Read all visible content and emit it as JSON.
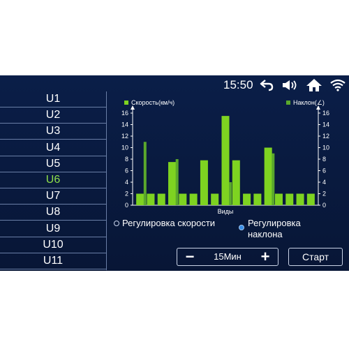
{
  "status": {
    "time": "15:50",
    "icons": [
      "back-arrow-icon",
      "volume-icon",
      "home-icon",
      "wifi-icon"
    ]
  },
  "sidebar": {
    "items": [
      "U1",
      "U2",
      "U3",
      "U4",
      "U5",
      "U6",
      "U7",
      "U8",
      "U9",
      "U10",
      "U11"
    ],
    "active_index": 5,
    "active_color": "#8fe04a"
  },
  "chart_data": {
    "type": "bar",
    "legend_left": "Скорость(км/ч)",
    "legend_right": "Наклон(∠)",
    "xlabel": "Виды",
    "ylim": [
      0,
      16
    ],
    "yticks": [
      0,
      2,
      4,
      6,
      8,
      10,
      12,
      14,
      16
    ],
    "series": [
      {
        "name": "Скорость(км/ч)",
        "color": "#7ed321",
        "values": [
          2,
          2,
          2,
          7.5,
          2,
          2,
          7.8,
          2,
          15.5,
          7.8,
          2,
          2,
          10,
          2,
          2,
          2,
          2
        ]
      },
      {
        "name": "Наклон(∠)",
        "color": "#5aa82c",
        "values": [
          0,
          11,
          0,
          0,
          8,
          0,
          0,
          0,
          0,
          4,
          0,
          0,
          0,
          9,
          0,
          0,
          0
        ]
      }
    ]
  },
  "mode": {
    "options": [
      "Регулировка скорости",
      "Регулировка\nнаклона"
    ],
    "selected_index": 1
  },
  "timer": {
    "minus_label": "−",
    "value": "15Мин",
    "plus_label": "+"
  },
  "start_label": "Старт"
}
